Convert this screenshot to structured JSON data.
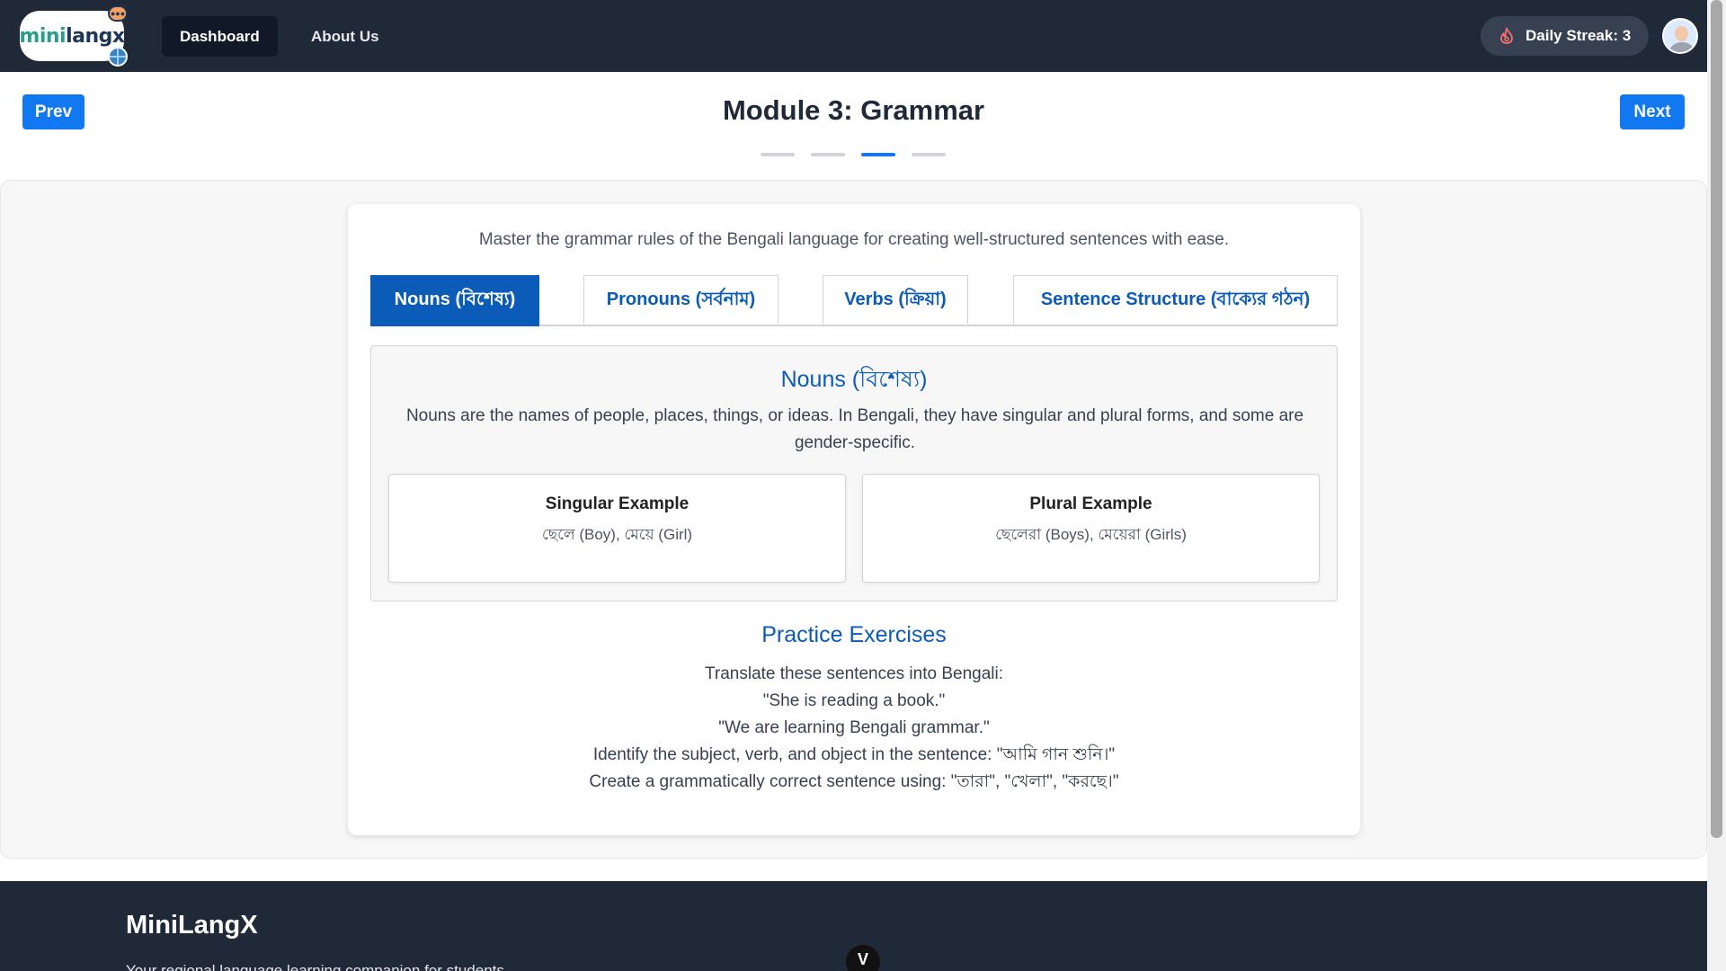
{
  "app": {
    "logo_text_mini": "mini",
    "logo_text_langx": "langx"
  },
  "nav": {
    "dashboard": "Dashboard",
    "about": "About Us",
    "streak": "Daily Streak: 3",
    "streak_icon": "flame-icon",
    "avatar_icon": "user-avatar"
  },
  "module": {
    "prev": "Prev",
    "next": "Next",
    "title": "Module 3: Grammar",
    "progress": {
      "current": 3,
      "total": 4
    }
  },
  "content": {
    "intro": "Master the grammar rules of the Bengali language for creating well-structured sentences with ease.",
    "tabs": [
      {
        "label": "Nouns (বিশেষ্য)",
        "active": true
      },
      {
        "label": "Pronouns (সর্বনাম)",
        "active": false
      },
      {
        "label": "Verbs (ক্রিয়া)",
        "active": false
      },
      {
        "label": "Sentence Structure (বাক্যের গঠন)",
        "active": false
      }
    ],
    "panel": {
      "title": "Nouns (বিশেষ্য)",
      "description": "Nouns are the names of people, places, things, or ideas. In Bengali, they have singular and plural forms, and some are gender-specific.",
      "examples": [
        {
          "title": "Singular Example",
          "text": "ছেলে (Boy), মেয়ে (Girl)"
        },
        {
          "title": "Plural Example",
          "text": "ছেলেরা (Boys), মেয়েরা (Girls)"
        }
      ]
    },
    "practice": {
      "title": "Practice Exercises",
      "items": [
        "Translate these sentences into Bengali:",
        "\"She is reading a book.\"",
        "\"We are learning Bengali grammar.\"",
        "Identify the subject, verb, and object in the sentence: \"আমি গান শুনি।\"",
        "Create a grammatically correct sentence using: \"তারা\", \"খেলা\", \"করছে।\""
      ]
    }
  },
  "footer": {
    "title": "MiniLangX",
    "tagline": "Your regional language learning companion for students",
    "scroll_top_glyph": "V"
  },
  "colors": {
    "nav_bg": "#1f2937",
    "accent": "#1178f2",
    "tab_active": "#0b5cb8"
  }
}
